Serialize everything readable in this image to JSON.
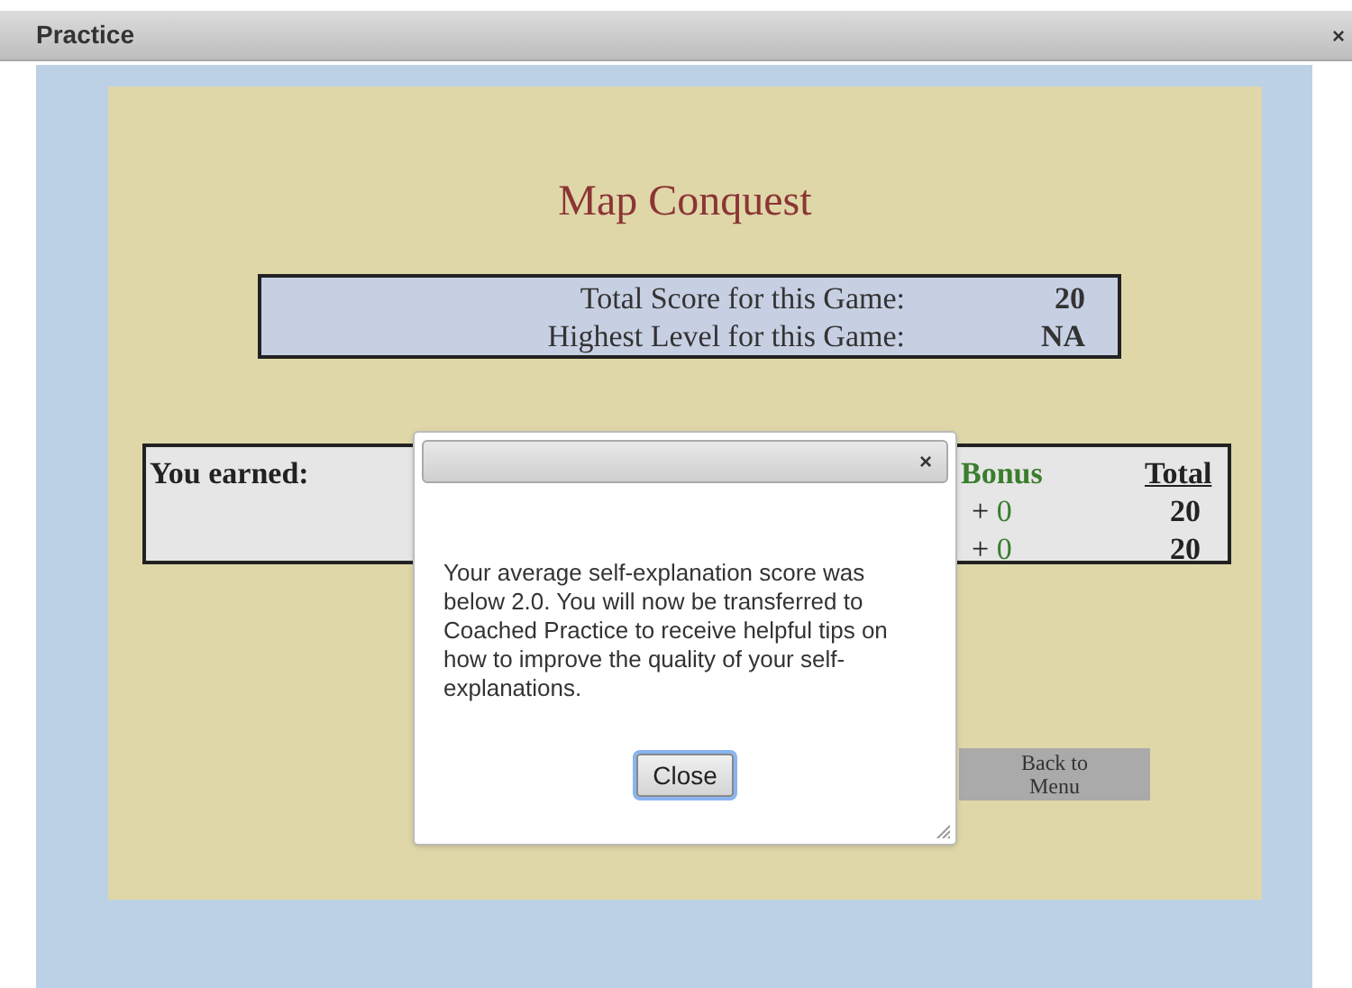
{
  "window": {
    "title": "Practice",
    "close": "×"
  },
  "game": {
    "title": "Map Conquest",
    "summary": [
      {
        "label": "Total Score for this Game:",
        "value": "20"
      },
      {
        "label": "Highest Level for this Game:",
        "value": "NA"
      }
    ],
    "earned": {
      "label": "You earned:",
      "columns": [
        "Bonus",
        "Total"
      ],
      "rows": [
        {
          "sign": "+",
          "bonus": "0",
          "total": "20"
        },
        {
          "sign": "+",
          "bonus": "0",
          "total": "20"
        }
      ]
    },
    "back_button": "Back to Menu"
  },
  "dialog": {
    "close": "×",
    "message": "Your average self-explanation score was below 2.0. You will now be transferred to Coached Practice to receive helpful tips on how to improve the quality of your self-explanations.",
    "button": "Close"
  }
}
